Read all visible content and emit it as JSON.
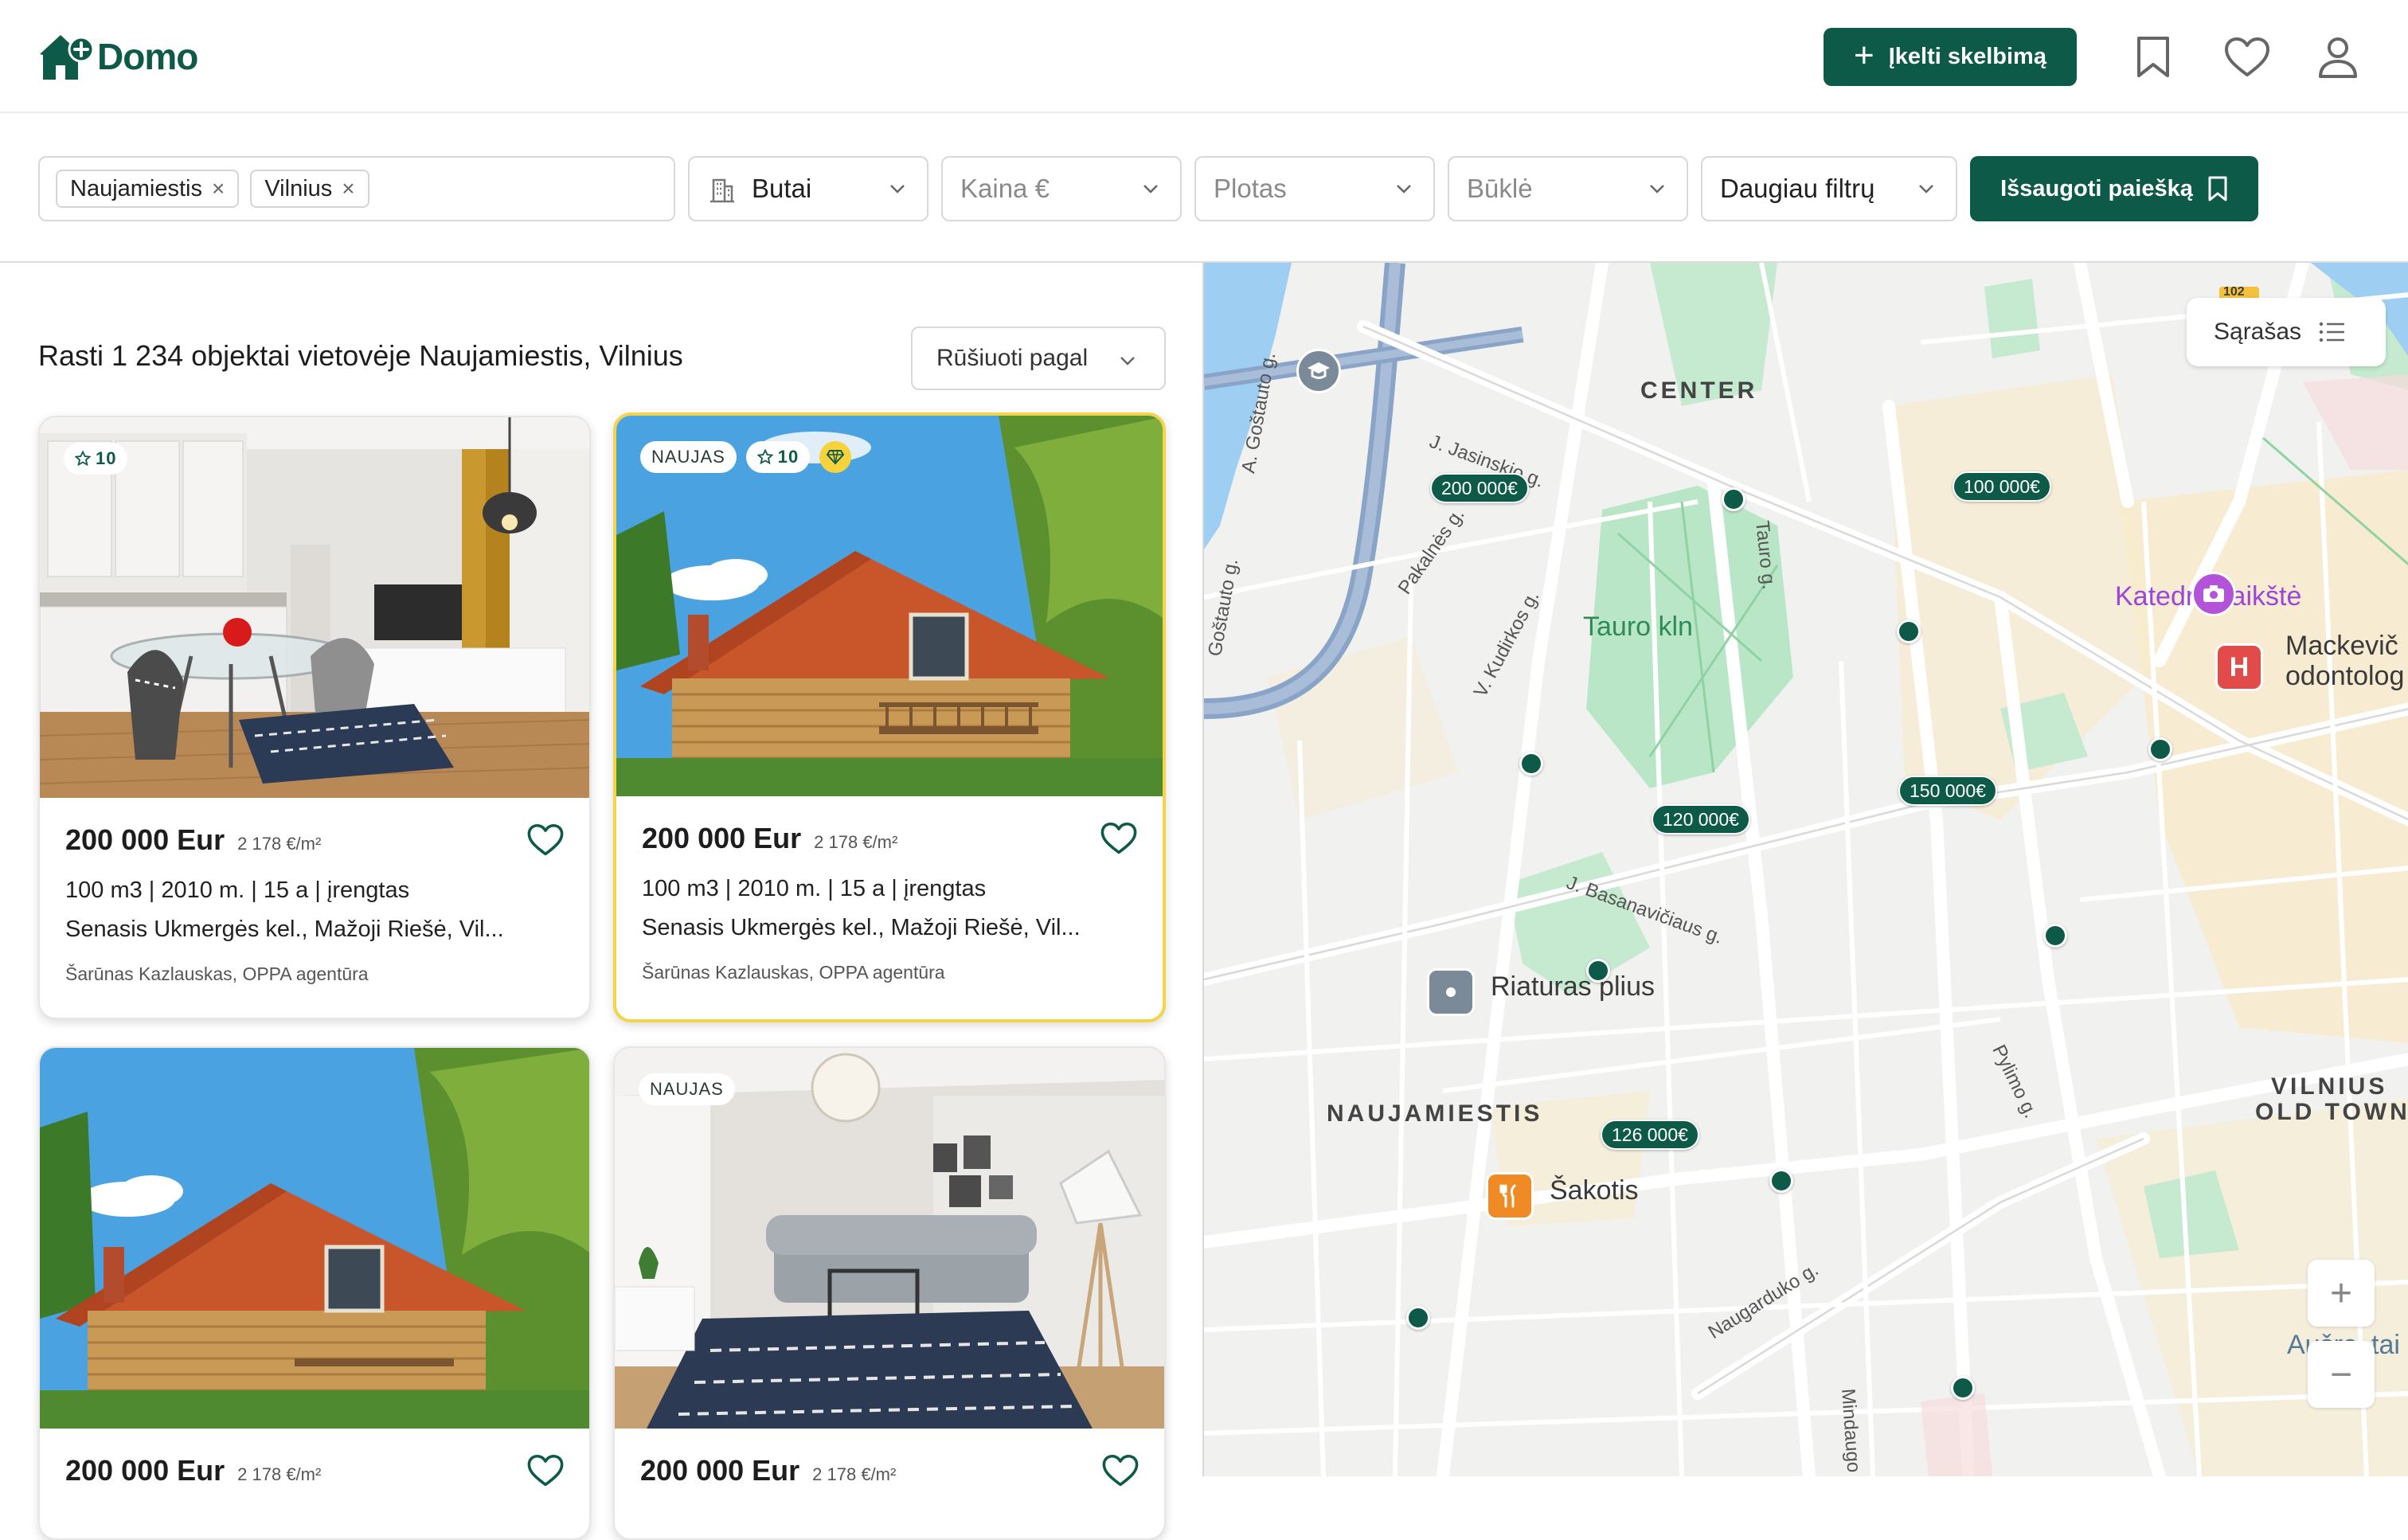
{
  "header": {
    "logo_text": "Domo",
    "post_button": "Įkelti skelbimą",
    "icons": [
      "bookmark-icon",
      "heart-icon",
      "user-icon"
    ]
  },
  "filters": {
    "location_chips": [
      "Naujamiestis",
      "Vilnius"
    ],
    "type": "Butai",
    "price_placeholder": "Kaina €",
    "area_placeholder": "Plotas",
    "condition_placeholder": "Būklė",
    "more_filters": "Daugiau filtrų",
    "save_search": "Išsaugoti paiešką"
  },
  "results": {
    "title": "Rasti 1 234 objektai vietovėje Naujamiestis, Vilnius",
    "sort_label": "Rūšiuoti pagal"
  },
  "listings": [
    {
      "badge_new": "",
      "rating": "10",
      "price": "200 000 Eur",
      "price_per_m2": "2 178 €/m²",
      "specs": "100 m3  |  2010 m.  |  15 a  |  įrengtas",
      "address": "Senasis Ukmergės kel., Mažoji Riešė, Vil...",
      "agent": "Šarūnas Kazlauskas, OPPA agentūra"
    },
    {
      "badge_new": "NAUJAS",
      "rating": "10",
      "price": "200 000 Eur",
      "price_per_m2": "2 178 €/m²",
      "specs": "100 m3  |  2010 m.  |  15 a  |  įrengtas",
      "address": "Senasis Ukmergės kel., Mažoji Riešė, Vil...",
      "agent": "Šarūnas Kazlauskas, OPPA agentūra"
    },
    {
      "badge_new": "",
      "rating": "",
      "price": "200 000 Eur",
      "price_per_m2": "2 178 €/m²"
    },
    {
      "badge_new": "NAUJAS",
      "rating": "",
      "price": "200 000 Eur",
      "price_per_m2": "2 178 €/m²"
    }
  ],
  "map": {
    "list_button": "Sąrašas",
    "districts": [
      "CENTER",
      "NAUJAMIESTIS",
      "VILNIUS",
      "OLD TOWN"
    ],
    "places": [
      "Tauro kln",
      "Katedros aikštė",
      "Mackevič",
      "odontolog",
      "Riaturas plius",
      "Šakotis",
      "Aušro",
      "tai"
    ],
    "streets": [
      "A. Goštauto g.",
      "Goštauto g.",
      "J. Jasinskio g.",
      "Pakalnės g.",
      "V. Kudirkos g.",
      "Tauro g.",
      "J. Basanavičiaus g.",
      "Pylimo g.",
      "Naugarduko g.",
      "Mindaugo g."
    ],
    "road_number": "102",
    "price_tags": [
      "200 000€",
      "100 000€",
      "120 000€",
      "150 000€",
      "126 000€"
    ],
    "zoom_in": "+",
    "zoom_out": "−"
  },
  "colors": {
    "brand": "#0e5a49",
    "highlight_border": "#f2d54a",
    "badge_gem": "#f6d23b"
  }
}
